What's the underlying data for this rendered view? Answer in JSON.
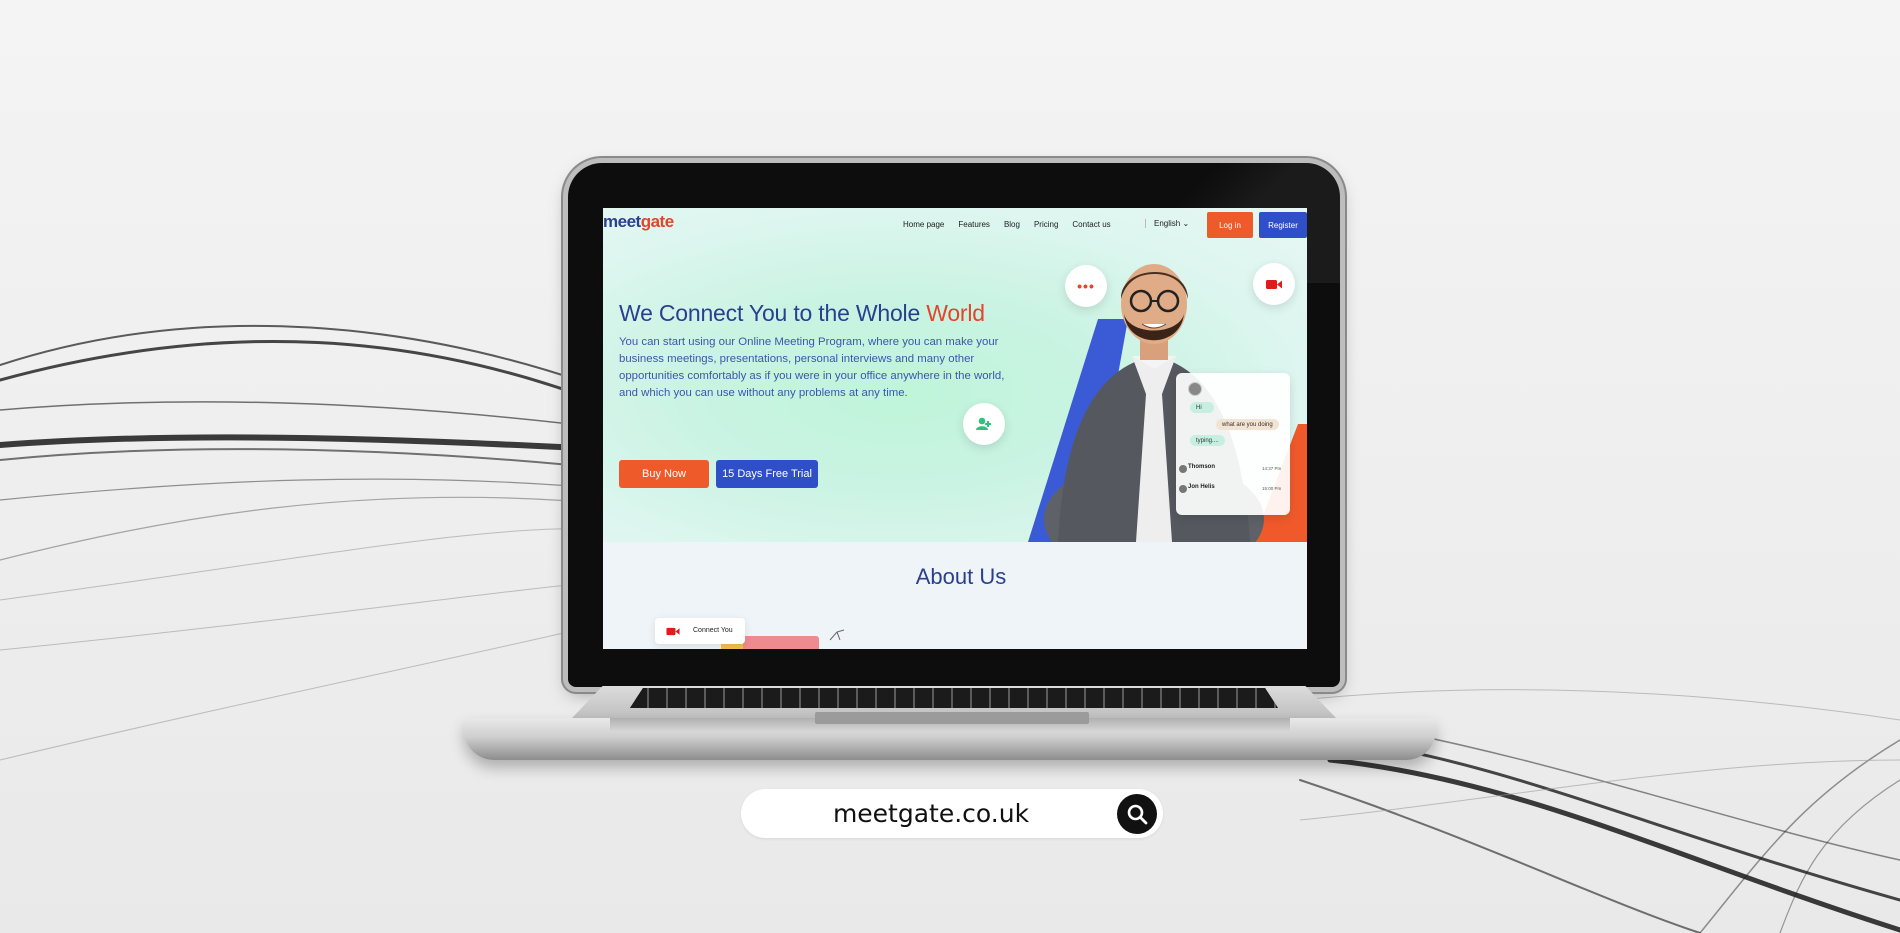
{
  "colors": {
    "brand_blue": "#2a3f8f",
    "brand_orange": "#e1462b",
    "button_orange": "#ef5a2b",
    "button_blue": "#2f4fc8",
    "hero_green": "#bff5da"
  },
  "site": {
    "logo": {
      "part1": "meet",
      "part2": "gate"
    },
    "nav": {
      "items": [
        "Home page",
        "Features",
        "Blog",
        "Pricing",
        "Contact us"
      ],
      "language": "English",
      "login_label": "Log in",
      "register_label": "Register"
    },
    "hero": {
      "title_main": "We Connect You to the Whole ",
      "title_highlight": "World",
      "text": "You can start using our Online Meeting Program, where you can make your business meetings, presentations, personal interviews and many other opportunities comfortably as if you were in your office anywhere in the world, and which you can use without any problems at any time.",
      "buy_label": "Buy Now",
      "trial_label": "15 Days Free Trial"
    },
    "chat": {
      "msg1": "Hi",
      "msg2": "what are you doing",
      "typing": "typing....",
      "contacts": [
        {
          "name": "Thomson",
          "time": "14:37 Pm"
        },
        {
          "name": "Jon Helis",
          "time": "15:00 Pm"
        }
      ]
    },
    "about": {
      "title": "About Us",
      "connect_label": "Connect You"
    }
  },
  "url_bar": {
    "text": "meetgate.co.uk",
    "icon": "search-icon"
  }
}
